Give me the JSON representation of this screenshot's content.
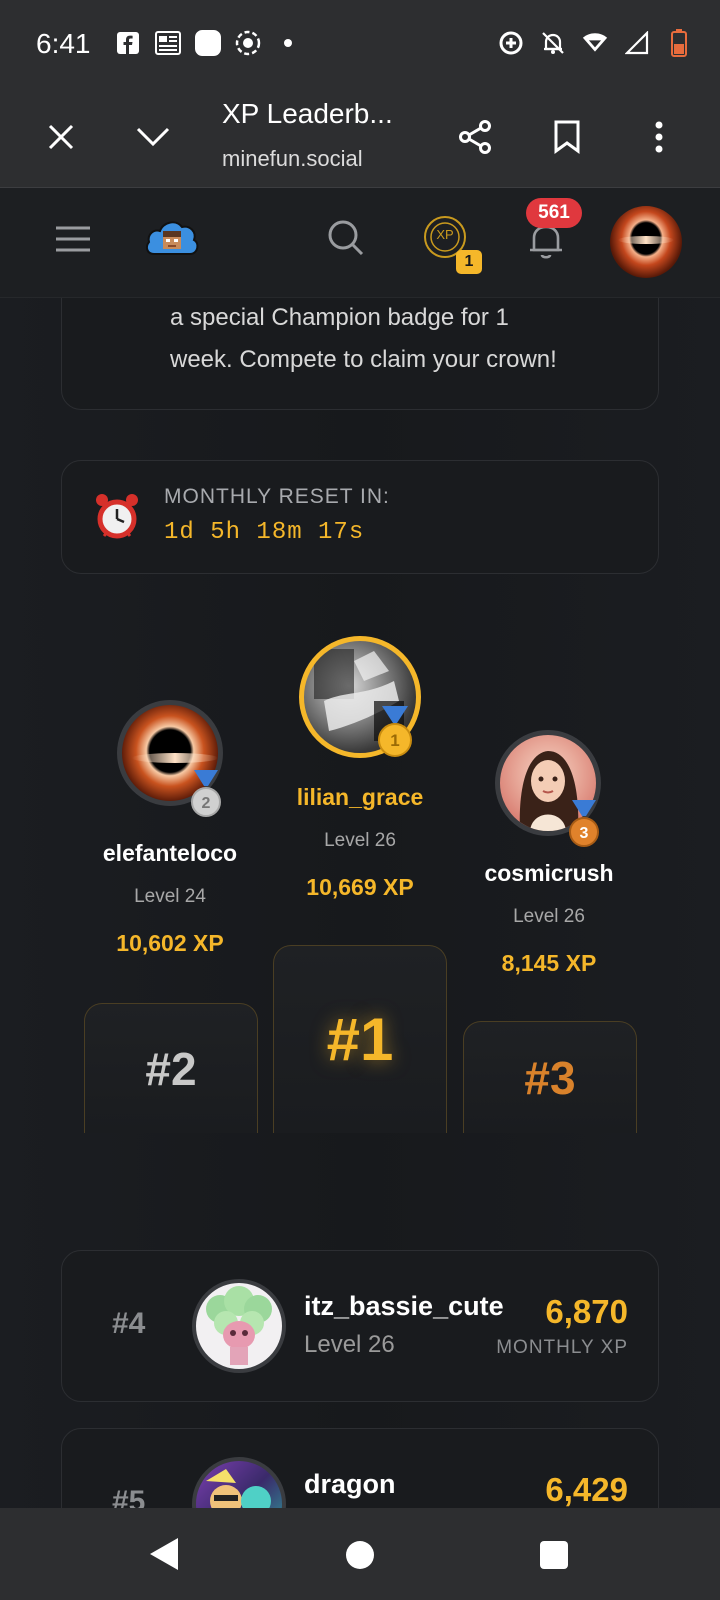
{
  "status": {
    "time": "6:41",
    "left_icons": [
      "facebook-icon",
      "news-icon",
      "app-square-icon",
      "screen-record-icon",
      "dot-icon"
    ],
    "right_icons": [
      "data-saver-icon",
      "bell-off-icon",
      "wifi-icon",
      "signal-icon",
      "battery-low-icon"
    ]
  },
  "browser": {
    "title": "XP Leaderb...",
    "url": "minefun.social",
    "close_icon": "close-icon",
    "collapse_icon": "chevron-down-icon",
    "share_icon": "share-icon",
    "bookmark_icon": "bookmark-icon",
    "more_icon": "more-vert-icon"
  },
  "appbar": {
    "xp_coin_label": "XP",
    "xp_badge": "1",
    "notif_count": "561"
  },
  "intro": {
    "text_line1": "a special Champion badge for 1",
    "text_line2": "week. Compete to claim your crown!"
  },
  "reset": {
    "label": "MONTHLY RESET IN:",
    "countdown": "1d 5h 18m 17s"
  },
  "podium": {
    "first": {
      "name": "lilian_grace",
      "level": "Level 26",
      "xp": "10,669 XP",
      "rank": "#1",
      "medal": "1"
    },
    "second": {
      "name": "elefanteloco",
      "level": "Level 24",
      "xp": "10,602 XP",
      "rank": "#2",
      "medal": "2"
    },
    "third": {
      "name": "cosmicrush",
      "level": "Level 26",
      "xp": "8,145 XP",
      "rank": "#3",
      "medal": "3"
    }
  },
  "rows": [
    {
      "rank": "#4",
      "name": "itz_bassie_cute",
      "level": "Level 26",
      "xp": "6,870",
      "xp_label": "MONTHLY XP"
    },
    {
      "rank": "#5",
      "name": "dragon",
      "level": "",
      "xp": "6,429",
      "xp_label": ""
    }
  ],
  "colors": {
    "gold": "#f5b72a",
    "silver": "#c8c8c8",
    "bronze": "#d9822b",
    "notif_red": "#e0383e"
  }
}
